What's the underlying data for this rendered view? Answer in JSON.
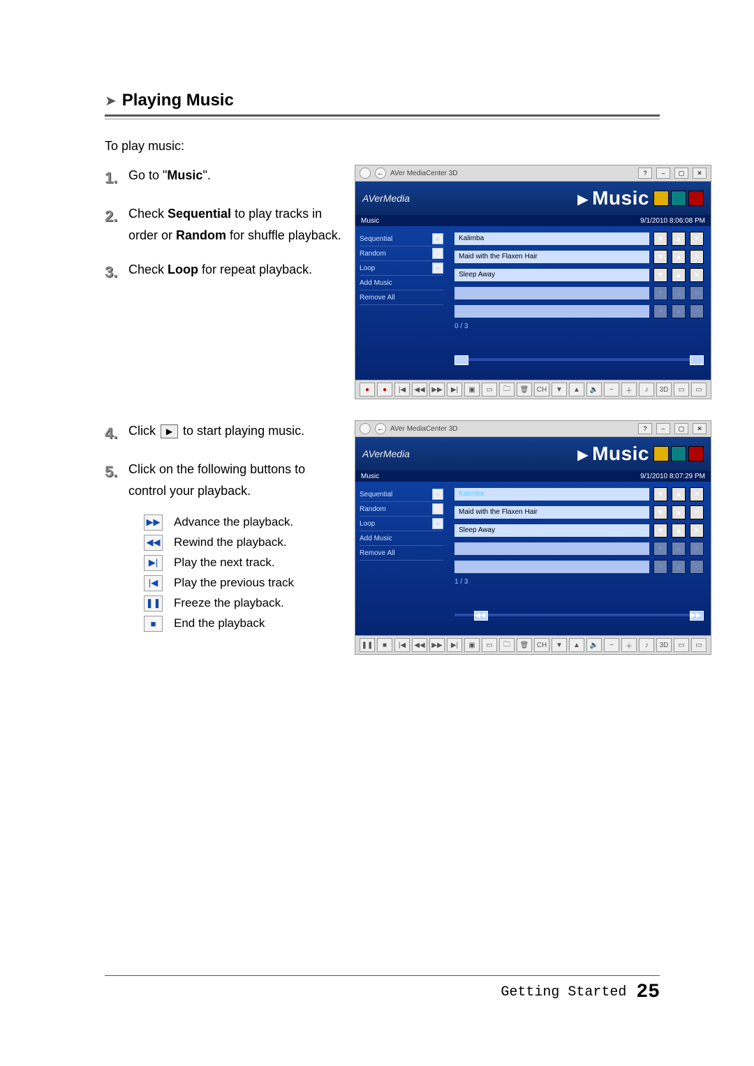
{
  "heading": "Playing Music",
  "intro": "To play music:",
  "steps": {
    "s1a": "Go to \"",
    "s1b": "Music",
    "s1c": "\".",
    "s2a": "Check ",
    "s2b": "Sequential",
    "s2c": " to play tracks in order or ",
    "s2d": "Random",
    "s2e": " for shuffle playback.",
    "s3a": "Check ",
    "s3b": "Loop",
    "s3c": " for repeat playback.",
    "s4a": "Click ",
    "s4b": " to start playing music.",
    "s5": "Click on the following buttons to control your playback."
  },
  "legend": {
    "i1": "Advance the playback.",
    "i2": "Rewind the playback.",
    "i3": "Play the next track.",
    "i4": "Play the previous track",
    "i5": "Freeze the playback.",
    "i6": "End the playback"
  },
  "shot": {
    "app_title": "AVer MediaCenter 3D",
    "brand": "AVerMedia",
    "section": "Music",
    "crumb": "Music",
    "time1": "9/1/2010 8:06:08 PM",
    "time2": "9/1/2010 8:07:29 PM",
    "sidebar": {
      "sequential": "Sequential",
      "random": "Random",
      "loop": "Loop",
      "add": "Add Music",
      "remove": "Remove All"
    },
    "tracks": [
      "Kalimba",
      "Maid with the Flaxen Hair",
      "Sleep Away"
    ],
    "counter1": "0 / 3",
    "counter2": "1 / 3",
    "ch": "CH",
    "threeD": "3D"
  },
  "footer": {
    "label": "Getting Started",
    "num": "25"
  }
}
